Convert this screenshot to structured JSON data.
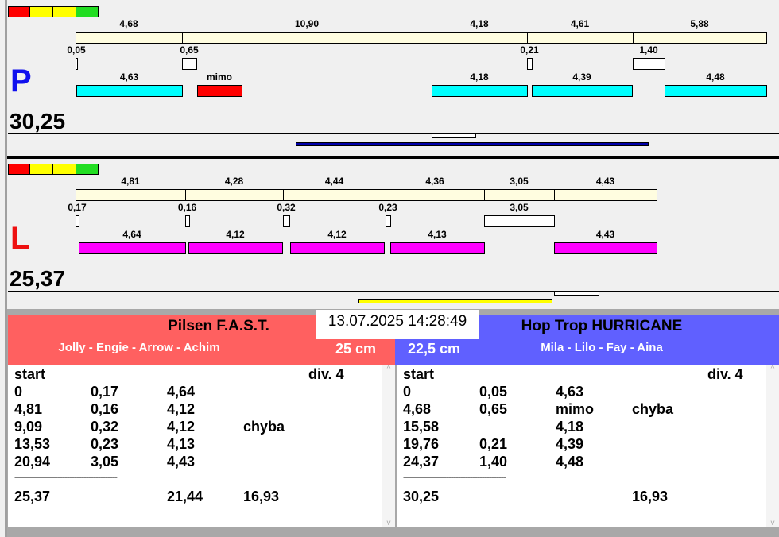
{
  "colors": {
    "red": "#ff0000",
    "yellow": "#ffff00",
    "green": "#22dd22",
    "cream": "#fffde0",
    "cyan": "#00ffff",
    "magenta": "#ff00ff",
    "team_left": "#ff6060",
    "team_right": "#6060ff",
    "bar_blue": "#0000aa",
    "bar_yellow": "#ffff00"
  },
  "track_p": {
    "letter": "P",
    "total": "30,25",
    "runs": [
      "4,68",
      "10,90",
      "4,18",
      "4,61",
      "5,88"
    ],
    "gaps": [
      "0,05",
      "0,65",
      "0,21",
      "1,40"
    ],
    "hits": [
      "4,63",
      "mimo",
      "4,18",
      "4,39",
      "4,48"
    ]
  },
  "track_l": {
    "letter": "L",
    "total": "25,37",
    "runs": [
      "4,81",
      "4,28",
      "4,44",
      "4,36",
      "3,05",
      "4,43"
    ],
    "gaps": [
      "0,17",
      "0,16",
      "0,32",
      "0,23",
      "3,05"
    ],
    "hits": [
      "4,64",
      "4,12",
      "4,12",
      "4,13",
      "4,43"
    ]
  },
  "datetime": "13.07.2025 14:28:49",
  "team_left": {
    "name": "Pilsen F.A.S.T.",
    "members": "Jolly - Engie - Arrow - Achim",
    "cm": "25 cm"
  },
  "team_right": {
    "name": "Hop Trop HURRICANE",
    "members": "Mila - Lilo - Fay - Aina",
    "cm": "22,5 cm"
  },
  "list_left": {
    "header": "start",
    "division": "div.  4",
    "rows": [
      [
        "0",
        "0,17",
        "4,64",
        ""
      ],
      [
        "4,81",
        "0,16",
        "4,12",
        ""
      ],
      [
        "9,09",
        "0,32",
        "4,12",
        "chyba"
      ],
      [
        "13,53",
        "0,23",
        "4,13",
        ""
      ],
      [
        "20,94",
        "3,05",
        "4,43",
        ""
      ]
    ],
    "separator": "-------------------------------------------",
    "totals": [
      "25,37",
      "",
      "21,44",
      "16,93"
    ]
  },
  "list_right": {
    "header": "start",
    "division": "div.  4",
    "rows": [
      [
        "0",
        "0,05",
        "4,63",
        ""
      ],
      [
        "4,68",
        "0,65",
        "mimo",
        "chyba"
      ],
      [
        "15,58",
        "",
        "4,18",
        ""
      ],
      [
        "19,76",
        "0,21",
        "4,39",
        ""
      ],
      [
        "24,37",
        "1,40",
        "4,48",
        ""
      ]
    ],
    "separator": "-------------------------------------------",
    "totals": [
      "30,25",
      "",
      "",
      "16,93"
    ]
  }
}
